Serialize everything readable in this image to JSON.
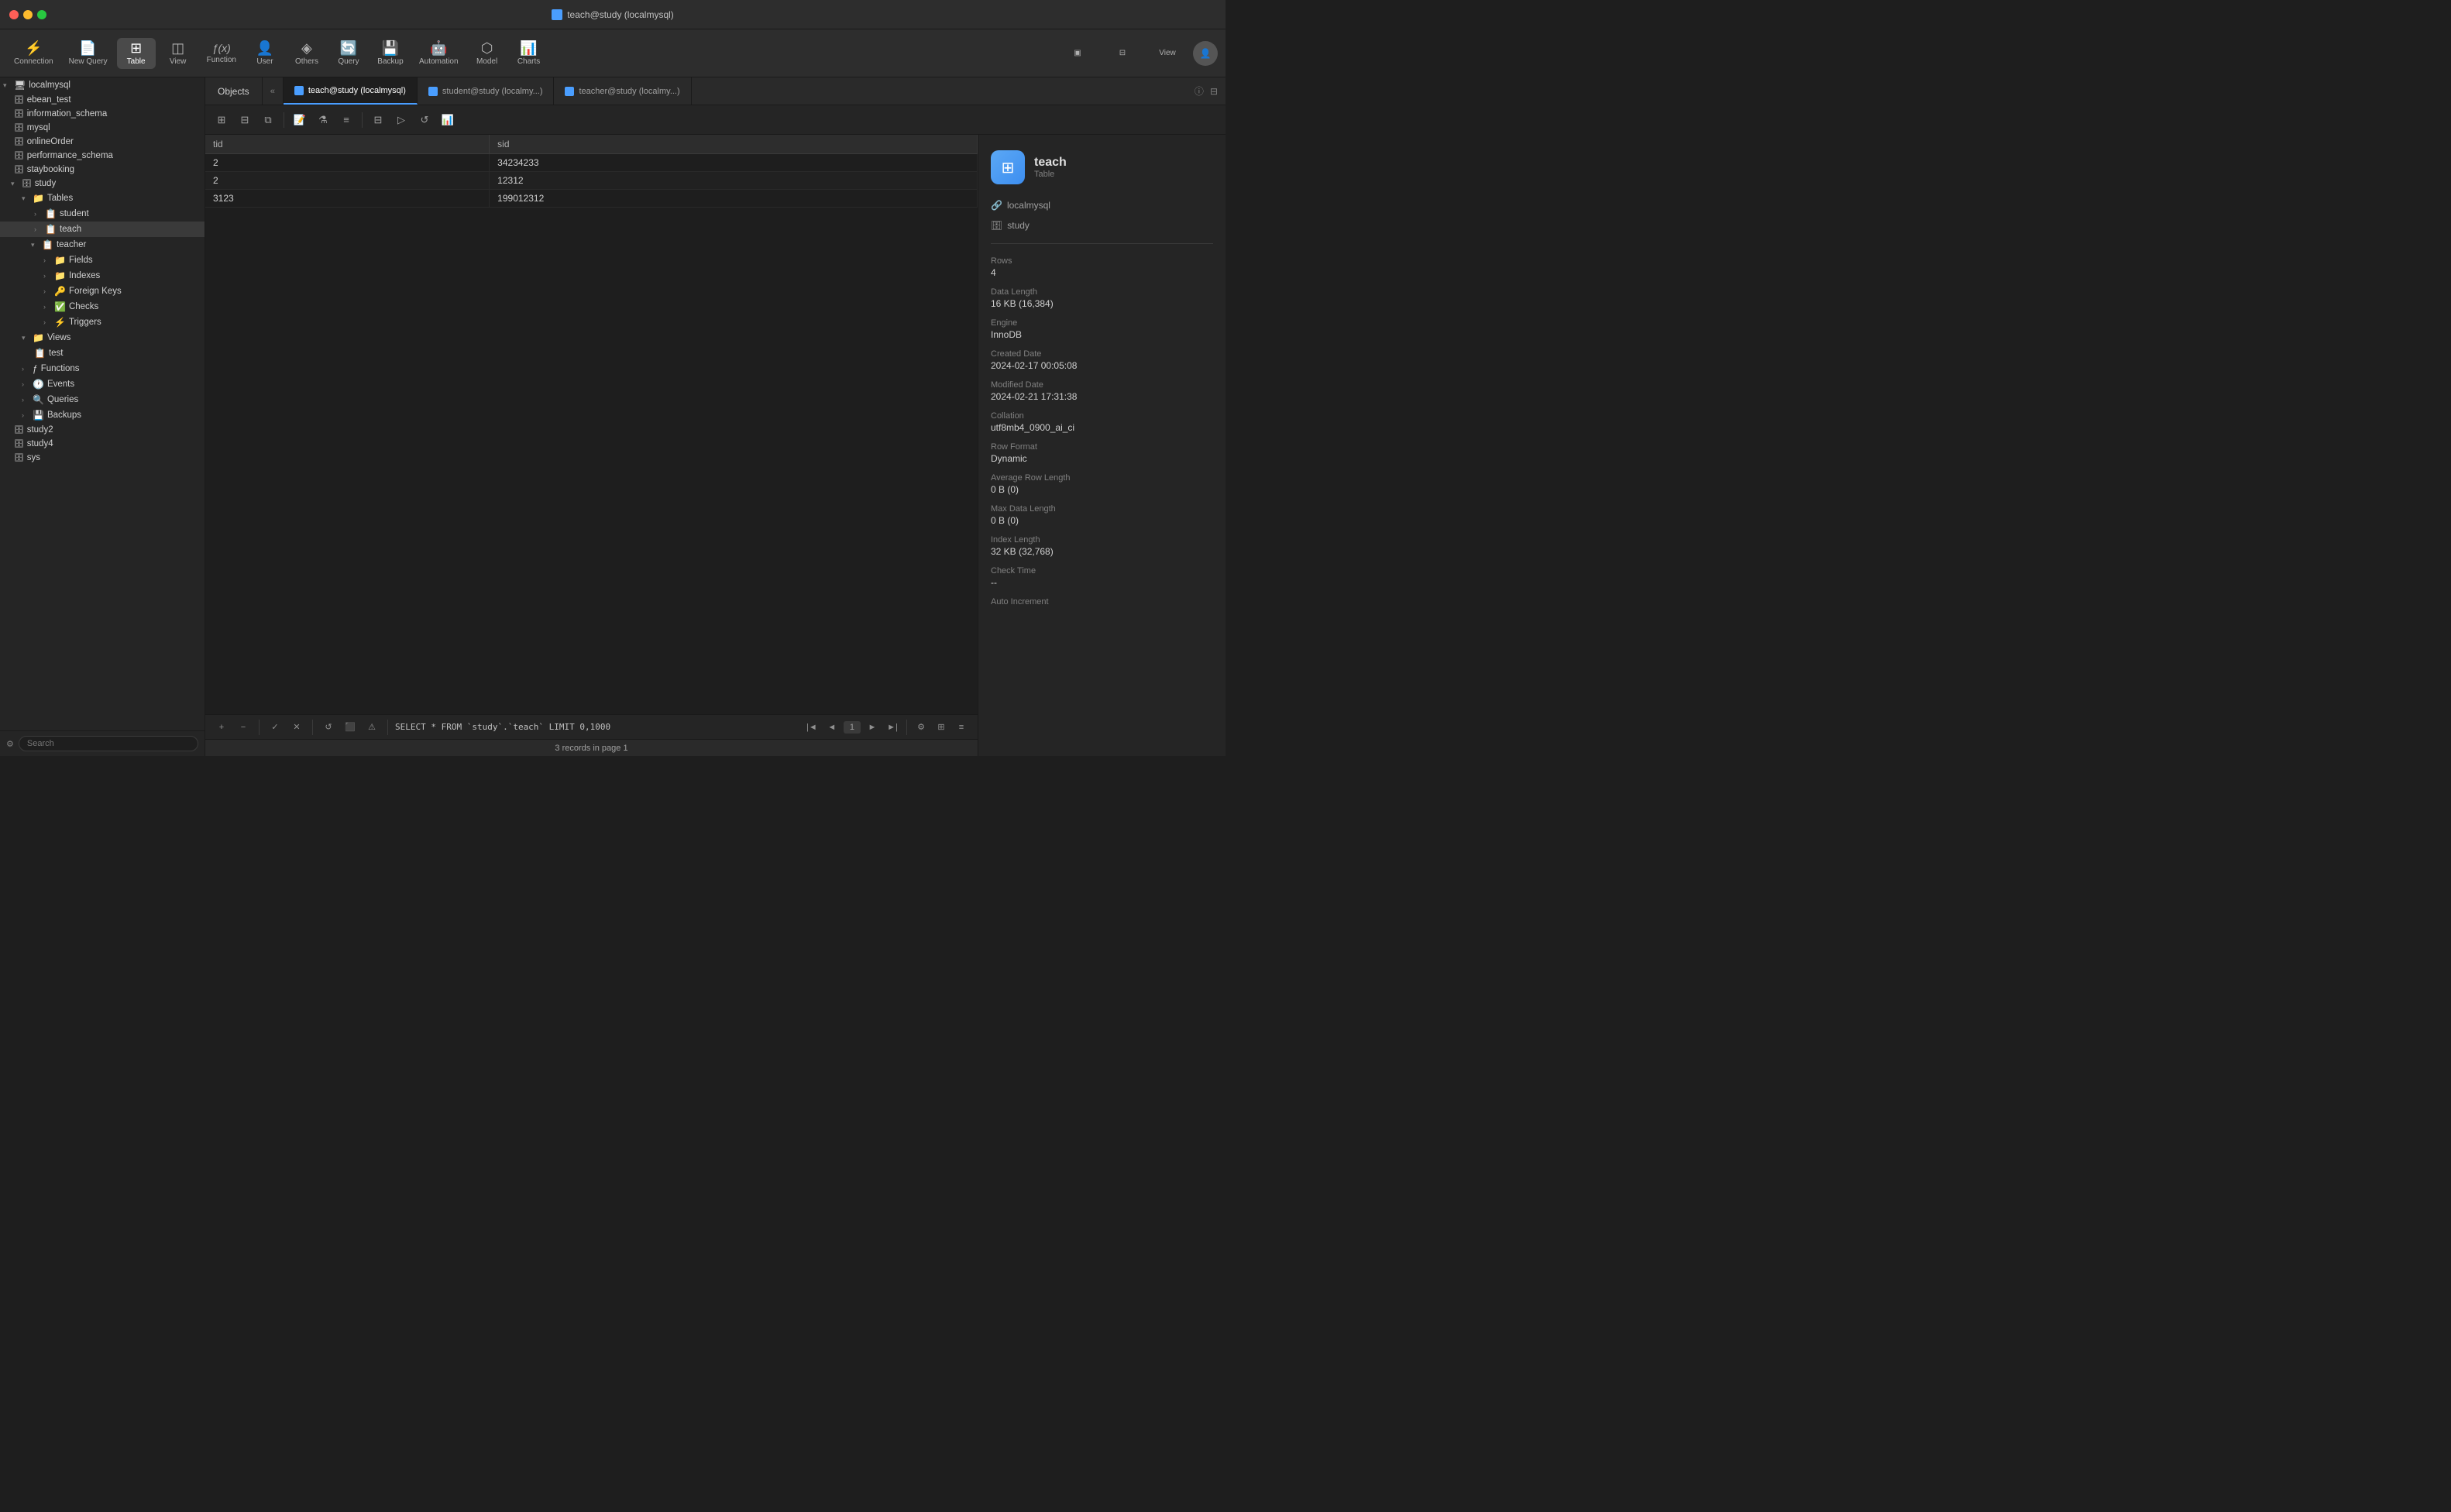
{
  "titlebar": {
    "title": "teach@study (localmysql)"
  },
  "toolbar": {
    "items": [
      {
        "id": "connection",
        "label": "Connection",
        "icon": "⚡"
      },
      {
        "id": "new-query",
        "label": "New Query",
        "icon": "📄"
      },
      {
        "id": "table",
        "label": "Table",
        "icon": "⊞"
      },
      {
        "id": "view",
        "label": "View",
        "icon": "◫"
      },
      {
        "id": "function",
        "label": "Function",
        "icon": "ƒ(x)"
      },
      {
        "id": "user",
        "label": "User",
        "icon": "👤"
      },
      {
        "id": "others",
        "label": "Others",
        "icon": "◈"
      },
      {
        "id": "query",
        "label": "Query",
        "icon": "🔄"
      },
      {
        "id": "backup",
        "label": "Backup",
        "icon": "💾"
      },
      {
        "id": "automation",
        "label": "Automation",
        "icon": "🤖"
      },
      {
        "id": "model",
        "label": "Model",
        "icon": "⬡"
      },
      {
        "id": "charts",
        "label": "Charts",
        "icon": "📊"
      }
    ],
    "view_label": "View"
  },
  "sidebar": {
    "search_placeholder": "Search",
    "tree": [
      {
        "id": "localmysql",
        "label": "localmysql",
        "level": 0,
        "type": "server",
        "expanded": true,
        "icon": "🖥"
      },
      {
        "id": "ebean_test",
        "label": "ebean_test",
        "level": 1,
        "type": "db",
        "icon": "🗄"
      },
      {
        "id": "information_schema",
        "label": "information_schema",
        "level": 1,
        "type": "db",
        "icon": "🗄"
      },
      {
        "id": "mysql",
        "label": "mysql",
        "level": 1,
        "type": "db",
        "icon": "🗄"
      },
      {
        "id": "onlineOrder",
        "label": "onlineOrder",
        "level": 1,
        "type": "db",
        "icon": "🗄"
      },
      {
        "id": "performance_schema",
        "label": "performance_schema",
        "level": 1,
        "type": "db",
        "icon": "🗄"
      },
      {
        "id": "staybooking",
        "label": "staybooking",
        "level": 1,
        "type": "db",
        "icon": "🗄"
      },
      {
        "id": "study",
        "label": "study",
        "level": 1,
        "type": "db",
        "expanded": true,
        "icon": "🗄"
      },
      {
        "id": "tables",
        "label": "Tables",
        "level": 2,
        "type": "folder",
        "expanded": true,
        "icon": "📁"
      },
      {
        "id": "student",
        "label": "student",
        "level": 3,
        "type": "table",
        "icon": "📋"
      },
      {
        "id": "teach",
        "label": "teach",
        "level": 3,
        "type": "table",
        "icon": "📋"
      },
      {
        "id": "teacher",
        "label": "teacher",
        "level": 3,
        "type": "table",
        "expanded": true,
        "icon": "📋"
      },
      {
        "id": "fields",
        "label": "Fields",
        "level": 4,
        "type": "folder",
        "icon": "📁"
      },
      {
        "id": "indexes",
        "label": "Indexes",
        "level": 4,
        "type": "folder",
        "icon": "📁"
      },
      {
        "id": "foreign-keys",
        "label": "Foreign Keys",
        "level": 4,
        "type": "folder",
        "icon": "📁"
      },
      {
        "id": "checks",
        "label": "Checks",
        "level": 4,
        "type": "folder",
        "icon": "📁"
      },
      {
        "id": "triggers",
        "label": "Triggers",
        "level": 4,
        "type": "folder",
        "icon": "📁"
      },
      {
        "id": "views",
        "label": "Views",
        "level": 2,
        "type": "folder",
        "expanded": true,
        "icon": "📁"
      },
      {
        "id": "test",
        "label": "test",
        "level": 3,
        "type": "view",
        "icon": "📋"
      },
      {
        "id": "functions",
        "label": "Functions",
        "level": 2,
        "type": "folder",
        "icon": "📁"
      },
      {
        "id": "events",
        "label": "Events",
        "level": 2,
        "type": "folder",
        "icon": "📁"
      },
      {
        "id": "queries",
        "label": "Queries",
        "level": 2,
        "type": "folder",
        "icon": "📁"
      },
      {
        "id": "backups",
        "label": "Backups",
        "level": 2,
        "type": "folder",
        "icon": "📁"
      },
      {
        "id": "study2",
        "label": "study2",
        "level": 1,
        "type": "db",
        "icon": "🗄"
      },
      {
        "id": "study4",
        "label": "study4",
        "level": 1,
        "type": "db",
        "icon": "🗄"
      },
      {
        "id": "sys",
        "label": "sys",
        "level": 1,
        "type": "db",
        "icon": "🗄"
      }
    ]
  },
  "tabs": [
    {
      "id": "objects",
      "label": "Objects",
      "active": false
    },
    {
      "id": "teach-study",
      "label": "teach@study (localmysql)",
      "active": true,
      "db": true
    },
    {
      "id": "student-study",
      "label": "student@study (localmy...",
      "active": false,
      "db": true
    },
    {
      "id": "teacher-study",
      "label": "teacher@study (localmy...",
      "active": false,
      "db": true
    }
  ],
  "subtoolbar": {
    "buttons": [
      "⊞",
      "⊟",
      "⧉",
      "📝",
      "⚗",
      "≡",
      "⊟",
      "⋯",
      "▷",
      "↺",
      "📊"
    ]
  },
  "table": {
    "columns": [
      "tid",
      "sid"
    ],
    "rows": [
      {
        "tid": "2",
        "sid": "34234233"
      },
      {
        "tid": "2",
        "sid": "12312"
      },
      {
        "tid": "3123",
        "sid": "199012312"
      }
    ]
  },
  "bottom": {
    "query": "SELECT * FROM `study`.`teach` LIMIT 0,1000",
    "page": "1",
    "status": "3 records in page 1",
    "warning_icon": "⚠"
  },
  "info_panel": {
    "table_name": "teach",
    "table_type": "Table",
    "connection": "localmysql",
    "database": "study",
    "rows": {
      "label": "Rows",
      "value": "4"
    },
    "data_length": {
      "label": "Data Length",
      "value": "16 KB (16,384)"
    },
    "engine": {
      "label": "Engine",
      "value": "InnoDB"
    },
    "created_date": {
      "label": "Created Date",
      "value": "2024-02-17 00:05:08"
    },
    "modified_date": {
      "label": "Modified Date",
      "value": "2024-02-21 17:31:38"
    },
    "collation": {
      "label": "Collation",
      "value": "utf8mb4_0900_ai_ci"
    },
    "row_format": {
      "label": "Row Format",
      "value": "Dynamic"
    },
    "avg_row_length": {
      "label": "Average Row Length",
      "value": "0 B (0)"
    },
    "max_data_length": {
      "label": "Max Data Length",
      "value": "0 B (0)"
    },
    "index_length": {
      "label": "Index Length",
      "value": "32 KB (32,768)"
    },
    "check_time": {
      "label": "Check Time",
      "value": "--"
    },
    "auto_increment": {
      "label": "Auto Increment",
      "value": ""
    }
  }
}
